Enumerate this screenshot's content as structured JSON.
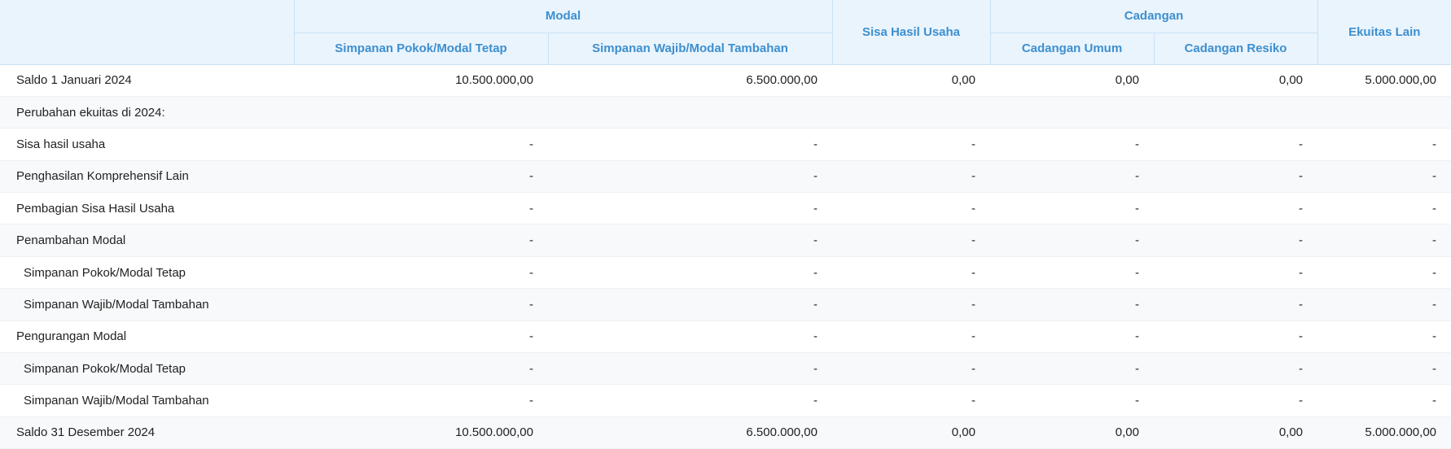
{
  "header": {
    "group_modal": "Modal",
    "col_simpanan_pokok": "Simpanan Pokok/Modal Tetap",
    "col_simpanan_wajib": "Simpanan Wajib/Modal Tambahan",
    "col_sisa_hasil_usaha": "Sisa Hasil Usaha",
    "group_cadangan": "Cadangan",
    "col_cadangan_umum": "Cadangan Umum",
    "col_cadangan_resiko": "Cadangan Resiko",
    "col_ekuitas_lain": "Ekuitas Lain"
  },
  "rows": [
    {
      "label": "Saldo 1 Januari 2024",
      "v1": "10.500.000,00",
      "v2": "6.500.000,00",
      "v3": "0,00",
      "v4": "0,00",
      "v5": "0,00",
      "v6": "5.000.000,00"
    },
    {
      "label": "Perubahan ekuitas di 2024:",
      "v1": "",
      "v2": "",
      "v3": "",
      "v4": "",
      "v5": "",
      "v6": ""
    },
    {
      "label": "Sisa hasil usaha",
      "v1": "-",
      "v2": "-",
      "v3": "-",
      "v4": "-",
      "v5": "-",
      "v6": "-"
    },
    {
      "label": "Penghasilan Komprehensif Lain",
      "v1": "-",
      "v2": "-",
      "v3": "-",
      "v4": "-",
      "v5": "-",
      "v6": "-"
    },
    {
      "label": "Pembagian Sisa Hasil Usaha",
      "v1": "-",
      "v2": "-",
      "v3": "-",
      "v4": "-",
      "v5": "-",
      "v6": "-"
    },
    {
      "label": "Penambahan Modal",
      "v1": "-",
      "v2": "-",
      "v3": "-",
      "v4": "-",
      "v5": "-",
      "v6": "-"
    },
    {
      "label": "Simpanan Pokok/Modal Tetap",
      "v1": "-",
      "v2": "-",
      "v3": "-",
      "v4": "-",
      "v5": "-",
      "v6": "-"
    },
    {
      "label": "Simpanan Wajib/Modal Tambahan",
      "v1": "-",
      "v2": "-",
      "v3": "-",
      "v4": "-",
      "v5": "-",
      "v6": "-"
    },
    {
      "label": "Pengurangan Modal",
      "v1": "-",
      "v2": "-",
      "v3": "-",
      "v4": "-",
      "v5": "-",
      "v6": "-"
    },
    {
      "label": "Simpanan Pokok/Modal Tetap",
      "v1": "-",
      "v2": "-",
      "v3": "-",
      "v4": "-",
      "v5": "-",
      "v6": "-"
    },
    {
      "label": "Simpanan Wajib/Modal Tambahan",
      "v1": "-",
      "v2": "-",
      "v3": "-",
      "v4": "-",
      "v5": "-",
      "v6": "-"
    },
    {
      "label": "Saldo 31 Desember 2024",
      "v1": "10.500.000,00",
      "v2": "6.500.000,00",
      "v3": "0,00",
      "v4": "0,00",
      "v5": "0,00",
      "v6": "5.000.000,00"
    }
  ]
}
